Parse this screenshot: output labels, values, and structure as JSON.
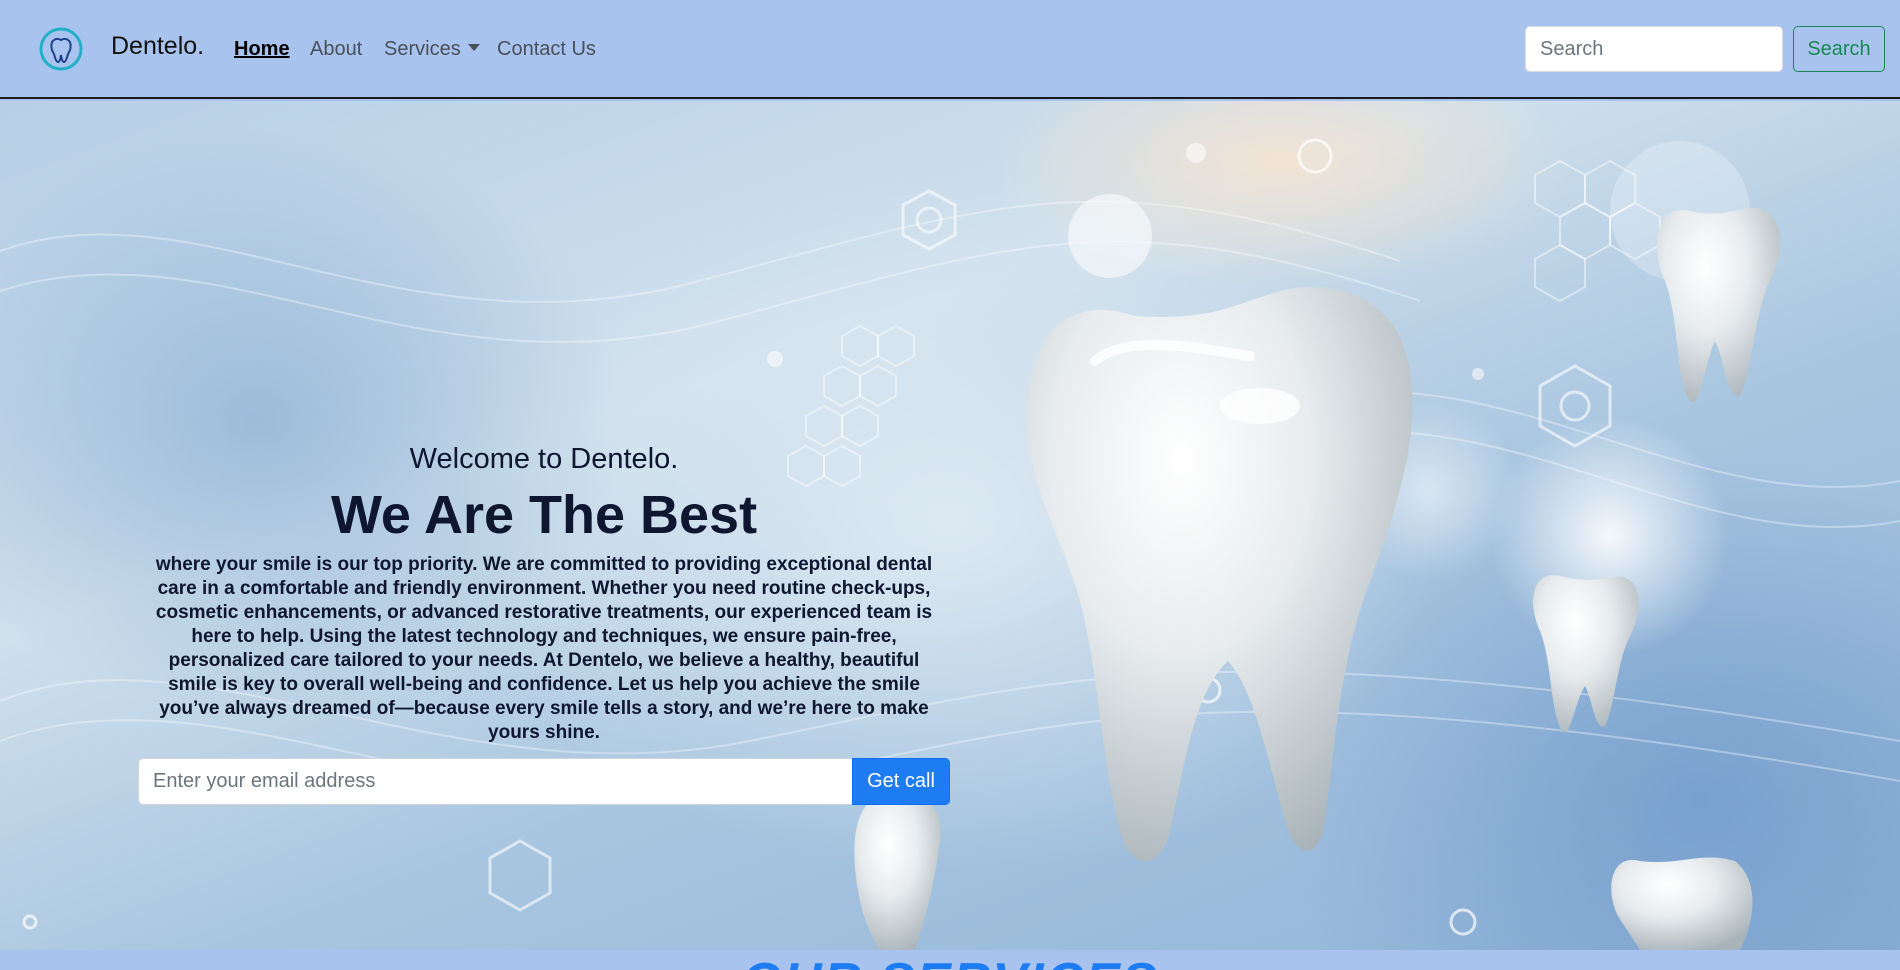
{
  "navbar": {
    "brand": "Dentelo.",
    "links": [
      {
        "label": "Home",
        "active": true
      },
      {
        "label": "About",
        "active": false
      },
      {
        "label": "Services",
        "active": false,
        "dropdown": true
      },
      {
        "label": "Contact Us",
        "active": false
      }
    ],
    "search": {
      "placeholder": "Search",
      "value": ""
    },
    "search_button": "Search",
    "logo_icon": "tooth-icon"
  },
  "hero": {
    "welcome": "Welcome to Dentelo.",
    "headline": "We Are The Best",
    "description": "where your smile is our top priority. We are committed to providing exceptional dental care in a comfortable and friendly environment. Whether you need routine check-ups, cosmetic enhancements, or advanced restorative treatments, our experienced team is here to help. Using the latest technology and techniques, we ensure pain-free, personalized care tailored to your needs. At Dentelo, we believe a healthy, beautiful smile is key to overall well-being and confidence. Let us help you achieve the smile you’ve always dreamed of—because every smile tells a story, and we’re here to make yours shine.",
    "email": {
      "placeholder": "Enter your email address",
      "value": ""
    },
    "cta_button": "Get call"
  },
  "services": {
    "title": "OUR SERVICES"
  },
  "colors": {
    "navbar_bg": "#a8c4ee",
    "search_button": "#198754",
    "cta_button": "#1e7cf2",
    "services_title": "#1e7cf2"
  }
}
